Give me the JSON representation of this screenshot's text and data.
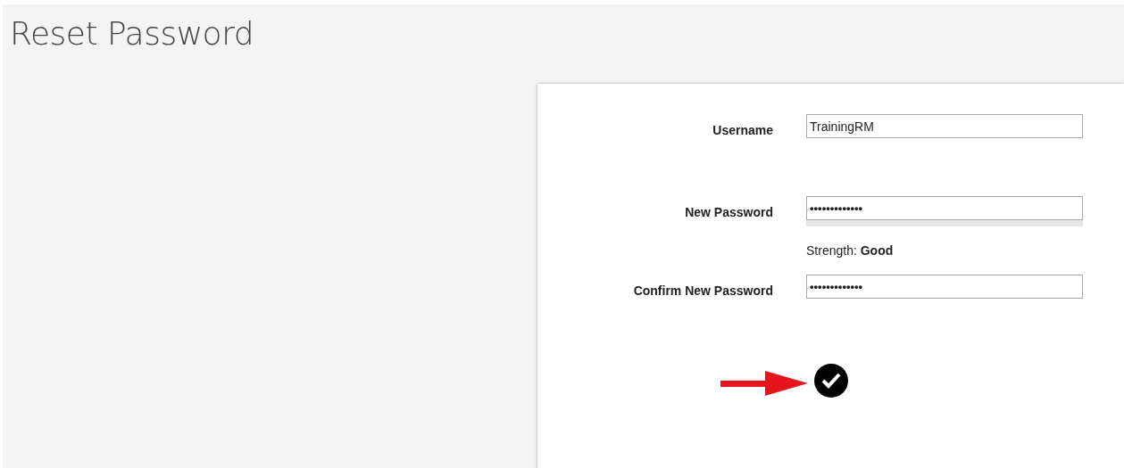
{
  "page": {
    "title": "Reset Password"
  },
  "fields": [
    {
      "label": "Username",
      "value": "TrainingRM",
      "kind": "text"
    },
    {
      "label": "New Password",
      "value": "•••••••••••••",
      "kind": "password",
      "strength_label": "Strength:",
      "strength": "Good"
    },
    {
      "label": "Confirm New Password",
      "value": "•••••••••••••",
      "kind": "password"
    }
  ]
}
